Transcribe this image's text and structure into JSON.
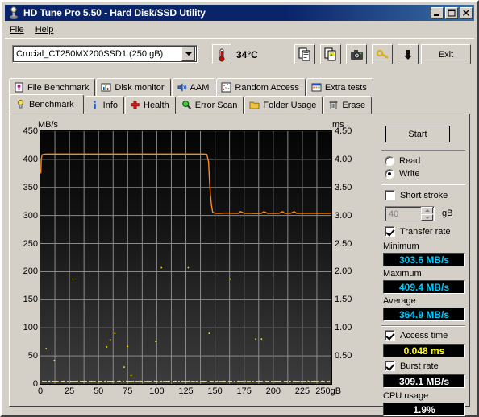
{
  "window": {
    "title": "HD Tune Pro 5.50 - Hard Disk/SSD Utility",
    "icon": "hdtune-app-icon",
    "minimize": "_",
    "maximize": "□",
    "close": "✕"
  },
  "menu": {
    "items": [
      {
        "label": "File",
        "accel": "F"
      },
      {
        "label": "Help",
        "accel": "H"
      }
    ]
  },
  "toolbar": {
    "drive_selected": "Crucial_CT250MX200SSD1 (250 gB)",
    "temperature": "34°C",
    "temp_icon": "thermometer-icon",
    "buttons": [
      {
        "name": "copy-text-icon",
        "title": "Copy text"
      },
      {
        "name": "copy-image-icon",
        "title": "Copy image"
      },
      {
        "name": "screenshot-camera-icon",
        "title": "Screenshot"
      },
      {
        "name": "registration-key-icon",
        "title": "Registration"
      },
      {
        "name": "save-down-arrow-icon",
        "title": "Save"
      }
    ],
    "exit_label": "Exit"
  },
  "tabs": {
    "top_row": [
      {
        "label": "File Benchmark",
        "icon": "file-benchmark-icon",
        "active": false
      },
      {
        "label": "Disk monitor",
        "icon": "disk-monitor-icon",
        "active": false
      },
      {
        "label": "AAM",
        "icon": "aam-speaker-icon",
        "active": false
      },
      {
        "label": "Random Access",
        "icon": "random-access-icon",
        "active": false
      },
      {
        "label": "Extra tests",
        "icon": "extra-tests-icon",
        "active": false
      }
    ],
    "bottom_row": [
      {
        "label": "Benchmark",
        "icon": "benchmark-bulb-icon",
        "active": true
      },
      {
        "label": "Info",
        "icon": "info-icon",
        "active": false
      },
      {
        "label": "Health",
        "icon": "health-cross-icon",
        "active": false
      },
      {
        "label": "Error Scan",
        "icon": "error-scan-magnifier-icon",
        "active": false
      },
      {
        "label": "Folder Usage",
        "icon": "folder-usage-icon",
        "active": false
      },
      {
        "label": "Erase",
        "icon": "erase-trash-icon",
        "active": false
      }
    ]
  },
  "panel": {
    "start_label": "Start",
    "mode": {
      "read_label": "Read",
      "write_label": "Write",
      "selected": "Write"
    },
    "short_stroke": {
      "label": "Short stroke",
      "checked": false,
      "value": "40",
      "unit": "gB",
      "enabled": false
    },
    "transfer_rate": {
      "label": "Transfer rate",
      "checked": true
    },
    "results": {
      "minimum_label": "Minimum",
      "minimum_value": "303.6 MB/s",
      "maximum_label": "Maximum",
      "maximum_value": "409.4 MB/s",
      "average_label": "Average",
      "average_value": "364.9 MB/s"
    },
    "access_time": {
      "label": "Access time",
      "checked": true,
      "value": "0.048 ms"
    },
    "burst_rate": {
      "label": "Burst rate",
      "checked": true,
      "value": "309.1 MB/s"
    },
    "cpu_usage": {
      "label": "CPU usage",
      "value": "1.9%"
    }
  },
  "chart_data": {
    "type": "line",
    "title": "",
    "ylabel": "MB/s",
    "ylabel_right": "ms",
    "xlabel": "gB",
    "xlim": [
      0,
      250
    ],
    "ylim": [
      0,
      450
    ],
    "ylim_right": [
      0,
      4.5
    ],
    "grid": true,
    "legend": "none",
    "xticks": [
      "0",
      "25",
      "50",
      "75",
      "100",
      "125",
      "150",
      "175",
      "200",
      "225",
      "250gB"
    ],
    "xtick_values": [
      0,
      25,
      50,
      75,
      100,
      125,
      150,
      175,
      200,
      225,
      250
    ],
    "yticks_left": [
      "450",
      "400",
      "350",
      "300",
      "250",
      "200",
      "150",
      "100",
      "50",
      "0"
    ],
    "ytick_values_left": [
      450,
      400,
      350,
      300,
      250,
      200,
      150,
      100,
      50,
      0
    ],
    "yticks_right": [
      "4.50",
      "4.00",
      "3.50",
      "3.00",
      "2.50",
      "2.00",
      "1.50",
      "1.00",
      "0.50"
    ],
    "ytick_values_right": [
      4.5,
      4.0,
      3.5,
      3.0,
      2.5,
      2.0,
      1.5,
      1.0,
      0.5
    ],
    "series": [
      {
        "name": "Write transfer rate",
        "color": "#ff8c1a",
        "axis": "left",
        "unit": "MB/s",
        "x": [
          0.4,
          0.8,
          1.5,
          3,
          6,
          10,
          15,
          20,
          25,
          30,
          35,
          40,
          45,
          50,
          55,
          60,
          65,
          70,
          75,
          80,
          85,
          90,
          95,
          100,
          105,
          110,
          115,
          120,
          125,
          130,
          135,
          140,
          143,
          144.5,
          145,
          145.5,
          146,
          147,
          148,
          150,
          155,
          160,
          165,
          170,
          172,
          175,
          180,
          185,
          190,
          192,
          195,
          200,
          205,
          208,
          210,
          215,
          218,
          220,
          225,
          230,
          235,
          240,
          245,
          250
        ],
        "y": [
          375,
          400,
          408,
          409,
          409.4,
          409.4,
          409.4,
          409.4,
          409.4,
          409.4,
          409.4,
          409.4,
          409.4,
          409.4,
          409.4,
          409.4,
          409.4,
          409.4,
          409.4,
          409.4,
          409.4,
          409.4,
          409.4,
          409.4,
          409.4,
          409.4,
          409.4,
          409.4,
          409.4,
          409.4,
          409.4,
          409.4,
          409,
          395,
          372,
          355,
          338,
          318,
          306,
          304,
          304,
          304.5,
          304,
          304,
          307,
          304,
          304,
          303.6,
          304,
          307,
          304,
          304,
          304,
          307,
          304,
          304,
          307,
          304,
          304,
          304,
          304,
          304,
          304,
          304
        ]
      },
      {
        "name": "Access time baseline",
        "color": "#ffe400",
        "axis": "right",
        "unit": "ms",
        "style": "dots-dense",
        "x": [
          2,
          8,
          14,
          20,
          26,
          32,
          38,
          44,
          50,
          56,
          62,
          68,
          74,
          80,
          86,
          92,
          98,
          104,
          110,
          116,
          122,
          128,
          134,
          140,
          146,
          152,
          158,
          164,
          170,
          176,
          182,
          188,
          194,
          200,
          206,
          212,
          218,
          224,
          230,
          236,
          242,
          248
        ],
        "y": [
          0.048,
          0.05,
          0.047,
          0.05,
          0.048,
          0.049,
          0.05,
          0.048,
          0.047,
          0.05,
          0.048,
          0.05,
          0.049,
          0.048,
          0.05,
          0.047,
          0.05,
          0.048,
          0.049,
          0.05,
          0.048,
          0.05,
          0.047,
          0.049,
          0.05,
          0.048,
          0.05,
          0.049,
          0.048,
          0.05,
          0.047,
          0.05,
          0.048,
          0.05,
          0.049,
          0.048,
          0.05,
          0.047,
          0.05,
          0.048,
          0.05,
          0.049
        ]
      },
      {
        "name": "Access time outliers",
        "color": "#ffe400",
        "axis": "right",
        "unit": "ms",
        "style": "scatter",
        "x": [
          5,
          12,
          28,
          57,
          60,
          64,
          72,
          75,
          78,
          99,
          104,
          127,
          145,
          163,
          185,
          190
        ],
        "y": [
          0.63,
          0.42,
          1.87,
          0.66,
          0.79,
          0.9,
          0.3,
          0.67,
          0.15,
          0.76,
          2.07,
          2.07,
          0.9,
          1.87,
          0.8,
          0.8
        ]
      }
    ]
  }
}
